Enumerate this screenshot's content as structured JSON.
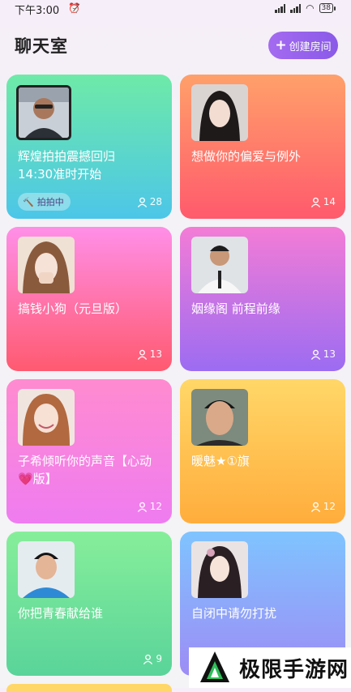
{
  "status_bar": {
    "time": "下午3:00",
    "alarm_icon": "alarm-off-icon",
    "battery": "38"
  },
  "header": {
    "title": "聊天室",
    "create_button": "创建房间"
  },
  "rooms": [
    {
      "name": "辉煌拍拍震撼回归\n14:30准时开始",
      "count": "28",
      "badge": "拍拍中"
    },
    {
      "name": "想做你的偏爱与例外",
      "count": "14"
    },
    {
      "name": "搞钱小狗（元旦版）",
      "count": "13"
    },
    {
      "name": "姻缘阁 前程前缘",
      "count": "13"
    },
    {
      "name": "子希倾听你的声音【心动💗版】",
      "count": "12"
    },
    {
      "name": "暖魅★①旗",
      "count": "12"
    },
    {
      "name": "你把青春献给谁",
      "count": "9"
    },
    {
      "name": "自闭中请勿打扰",
      "count": ""
    }
  ],
  "watermark": {
    "text": "极限手游网"
  },
  "colors": {
    "accent": "#8a5ae8"
  }
}
